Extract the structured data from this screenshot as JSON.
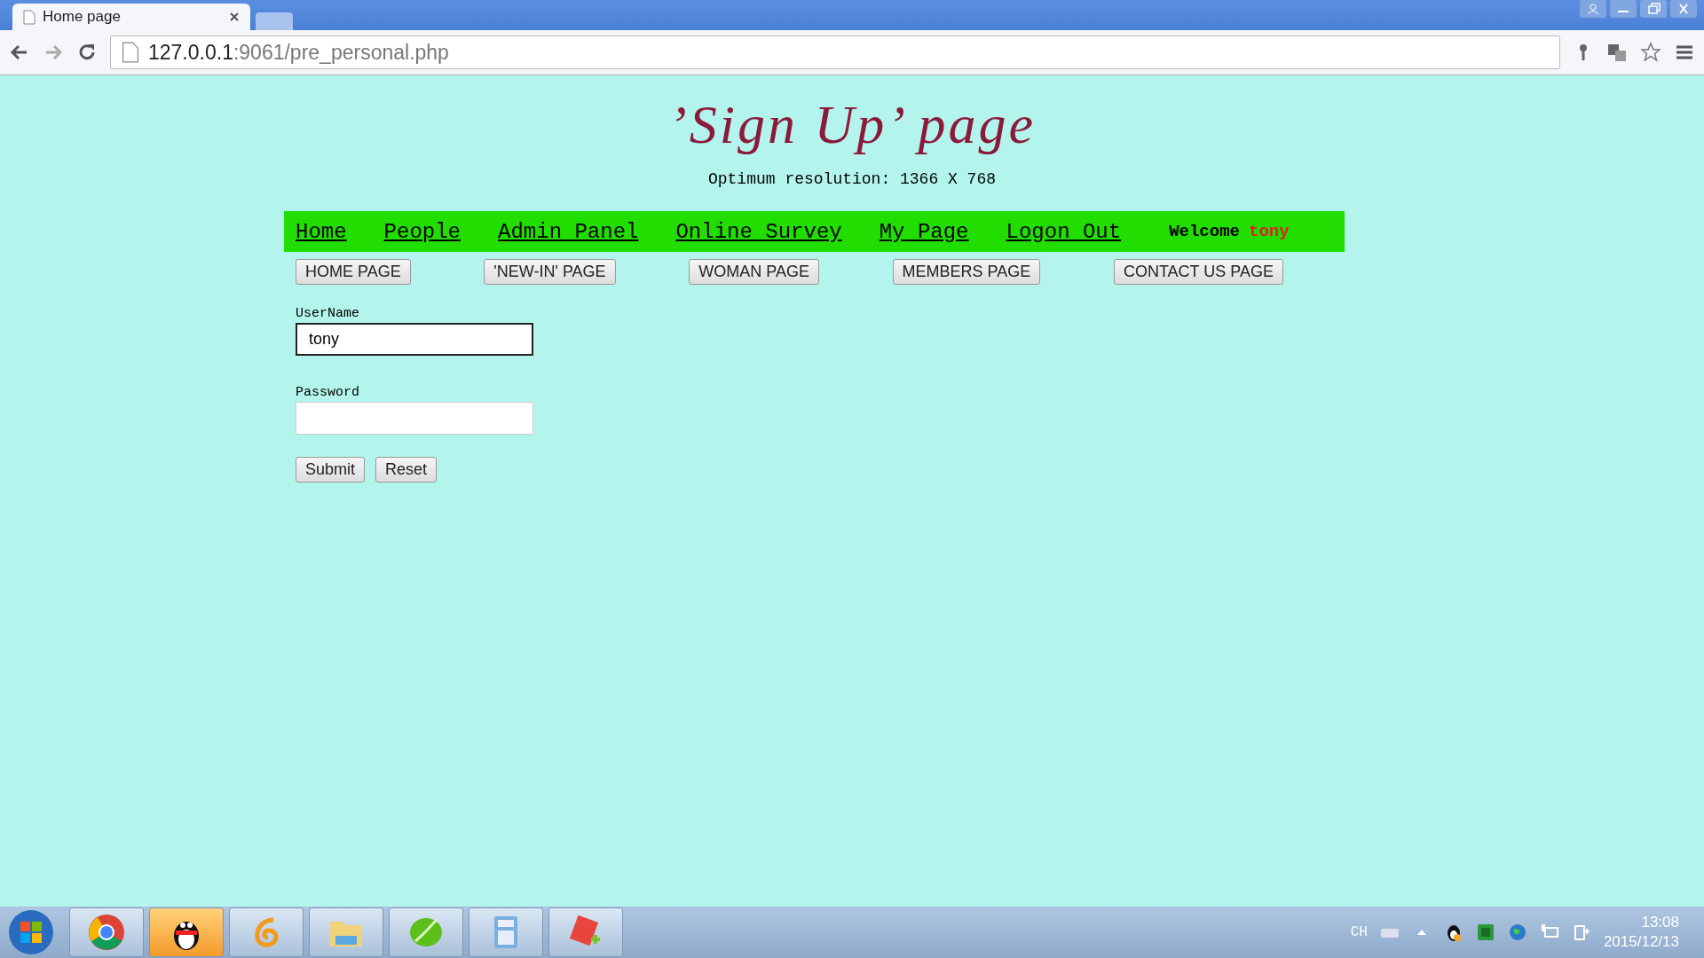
{
  "browser": {
    "tabs": [
      {
        "title": "Home page",
        "selected": true
      }
    ],
    "address": {
      "host": "127.0.0.1",
      "path": ":9061/pre_personal.php"
    }
  },
  "page": {
    "title": "’Sign Up’ page",
    "subtitle": "Optimum resolution: 1366 X 768",
    "nav": {
      "links": [
        "Home",
        "People",
        "Admin Panel",
        "Online Survey",
        "My Page",
        "Logon Out"
      ],
      "welcome": "Welcome",
      "user": "tony"
    },
    "buttons": [
      "HOME PAGE",
      "'NEW-IN' PAGE",
      "WOMAN PAGE",
      "MEMBERS PAGE",
      "CONTACT US PAGE"
    ],
    "form": {
      "fields": [
        {
          "label": "UserName",
          "value": "tony",
          "focused": true
        },
        {
          "label": "Password",
          "focused": false
        }
      ],
      "actions": [
        "Submit",
        "Reset"
      ]
    }
  },
  "taskbar": {
    "apps": [
      {
        "kind": "chrome",
        "highlighted": false
      },
      {
        "kind": "penguin",
        "highlighted": true
      },
      {
        "kind": "swirl",
        "highlighted": false
      },
      {
        "kind": "folder",
        "highlighted": false
      },
      {
        "kind": "leaf",
        "highlighted": false
      },
      {
        "kind": "calculator",
        "highlighted": false
      },
      {
        "kind": "notepad",
        "highlighted": false
      }
    ],
    "tray": {
      "language": "CH",
      "time": "13:08",
      "date": "2015/12/13"
    }
  }
}
